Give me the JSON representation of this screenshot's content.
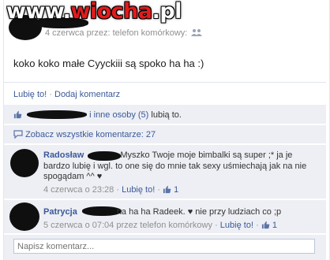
{
  "watermark": {
    "prefix": "www.",
    "brand": "wiocha",
    "suffix": ".pl"
  },
  "post": {
    "meta_date": "4 czerwca przez: telefon komórkowy:",
    "text": "koko koko małe Cyyckiii są spoko ha ha :)"
  },
  "actions": {
    "like": "Lubię to!",
    "separator": "·",
    "comment": "Dodaj komentarz"
  },
  "likes": {
    "others_link": "i inne osoby (5)",
    "suffix": "lubią to."
  },
  "all_comments": {
    "label": "Zobacz wszystkie komentarze: 27"
  },
  "comments": [
    {
      "author": "Radosław",
      "text": "Myszko Twoje moje bimbalki są super ;* ja je bardzo lubię i wgl. to one się do mnie tak sexy uśmiechają jak na nie spogądam ^^ ♥",
      "time": "4 czerwca o 23:28",
      "like": "Lubię to!",
      "like_count": "1"
    },
    {
      "author": "Patrycja",
      "text": "ha ha ha Radeek. ♥ nie przy ludziach co ;p",
      "time": "5 czerwca o 07:04 przez telefon komórkowy",
      "like": "Lubię to!",
      "like_count": "1"
    }
  ],
  "composer": {
    "placeholder": "Napisz komentarz..."
  },
  "colors": {
    "link": "#3b5998",
    "meta": "#8f8f8f",
    "strip": "#edeff4",
    "watermark_brand": "#e21b1b"
  },
  "icons": [
    "thumbs-up-icon",
    "comment-bubble-icon",
    "people-icon"
  ]
}
